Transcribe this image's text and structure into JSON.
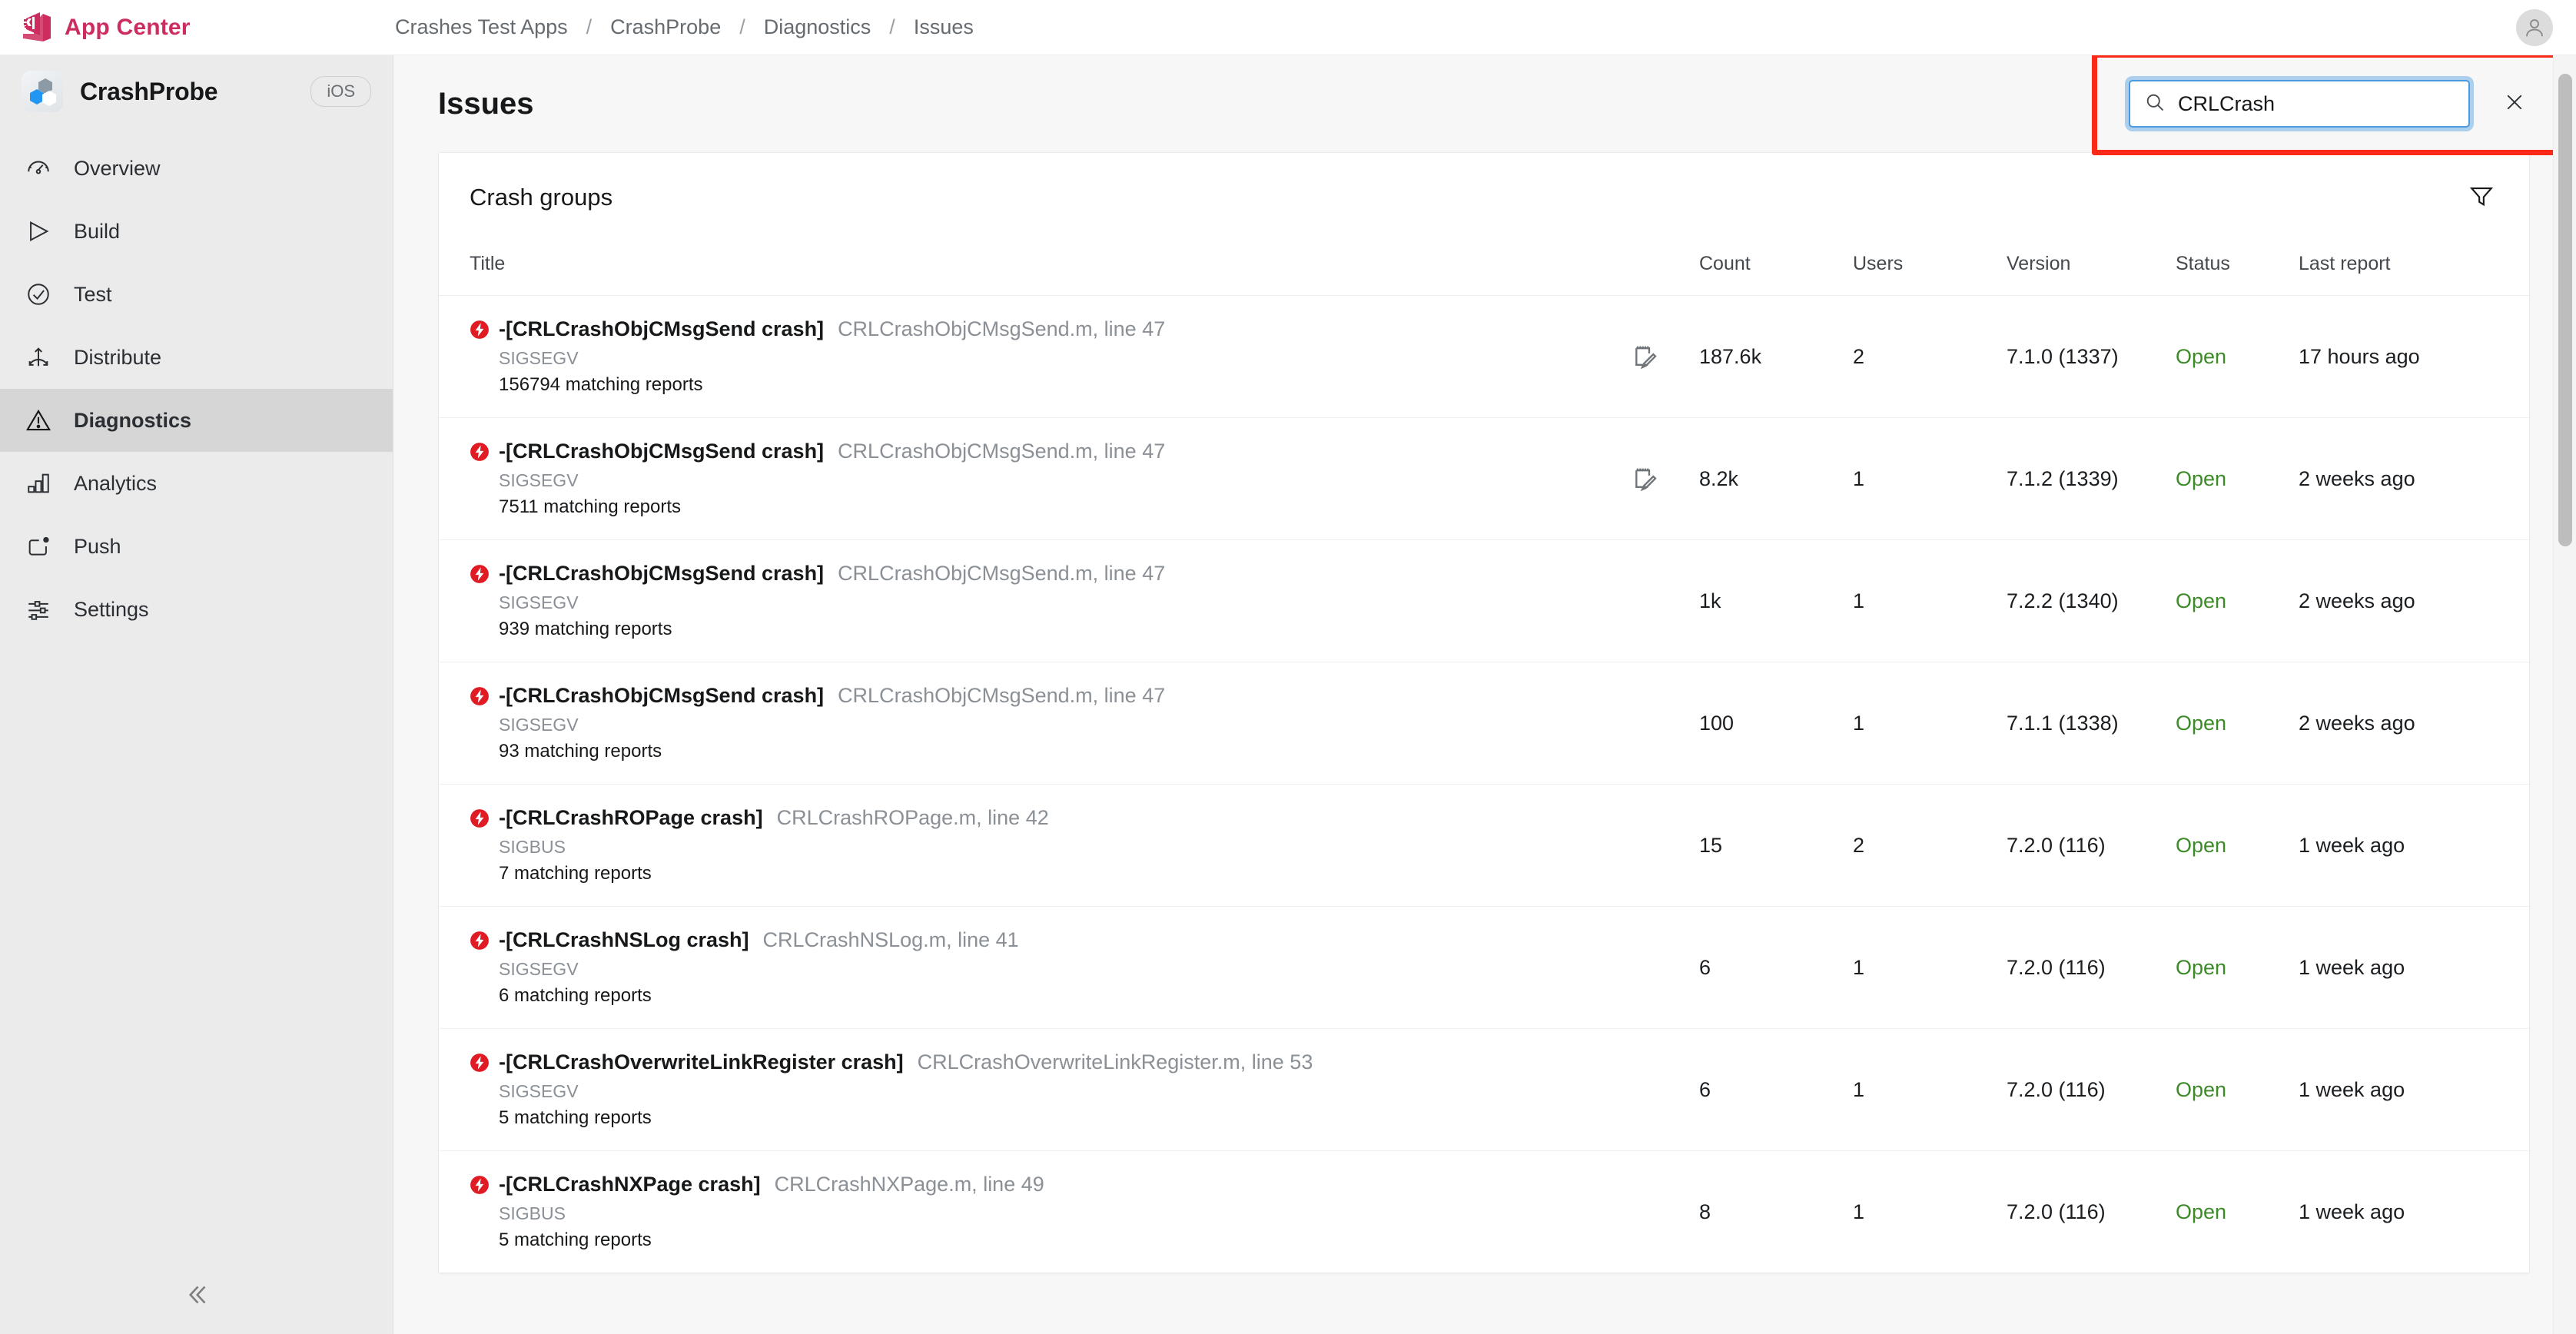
{
  "topbar": {
    "brand_name": "App Center",
    "brand_logo_icon": "app-center-logo",
    "avatar_icon": "user-avatar-icon",
    "breadcrumb": [
      {
        "label": "Crashes Test Apps"
      },
      {
        "label": "CrashProbe"
      },
      {
        "label": "Diagnostics"
      },
      {
        "label": "Issues"
      }
    ],
    "breadcrumb_separator": "/"
  },
  "sidebar": {
    "app_name": "CrashProbe",
    "app_icon": "crashprobe-app-icon",
    "os_badge": "iOS",
    "collapse_icon": "chevron-double-left-icon",
    "items": [
      {
        "label": "Overview",
        "icon": "gauge-icon",
        "active": false
      },
      {
        "label": "Build",
        "icon": "play-icon",
        "active": false
      },
      {
        "label": "Test",
        "icon": "check-circle-icon",
        "active": false
      },
      {
        "label": "Distribute",
        "icon": "distribute-icon",
        "active": false
      },
      {
        "label": "Diagnostics",
        "icon": "warning-triangle-icon",
        "active": true
      },
      {
        "label": "Analytics",
        "icon": "bar-chart-icon",
        "active": false
      },
      {
        "label": "Push",
        "icon": "push-icon",
        "active": false
      },
      {
        "label": "Settings",
        "icon": "sliders-icon",
        "active": false
      }
    ]
  },
  "main": {
    "page_title": "Issues",
    "search": {
      "value": "CRLCrash",
      "placeholder": "Search",
      "search_icon": "search-icon",
      "clear_icon": "close-icon",
      "highlight_color": "#fb2a18",
      "focus_color": "#4a9ae0"
    },
    "card": {
      "title": "Crash groups",
      "filter_icon": "filter-funnel-icon",
      "columns": {
        "title": "Title",
        "count": "Count",
        "users": "Users",
        "version": "Version",
        "status": "Status",
        "last_report": "Last report"
      },
      "status_color": "#3c8a28",
      "crash_icon": "crash-bolt-icon",
      "note_icon": "note-edit-icon",
      "rows": [
        {
          "method": "-[CRLCrashObjCMsgSend crash]",
          "file": "CRLCrashObjCMsgSend.m, line 47",
          "signal": "SIGSEGV",
          "reports": "156794 matching reports",
          "has_note": true,
          "count": "187.6k",
          "users": "2",
          "version": "7.1.0 (1337)",
          "status": "Open",
          "last_report": "17 hours ago"
        },
        {
          "method": "-[CRLCrashObjCMsgSend crash]",
          "file": "CRLCrashObjCMsgSend.m, line 47",
          "signal": "SIGSEGV",
          "reports": "7511 matching reports",
          "has_note": true,
          "count": "8.2k",
          "users": "1",
          "version": "7.1.2 (1339)",
          "status": "Open",
          "last_report": "2 weeks ago"
        },
        {
          "method": "-[CRLCrashObjCMsgSend crash]",
          "file": "CRLCrashObjCMsgSend.m, line 47",
          "signal": "SIGSEGV",
          "reports": "939 matching reports",
          "has_note": false,
          "count": "1k",
          "users": "1",
          "version": "7.2.2 (1340)",
          "status": "Open",
          "last_report": "2 weeks ago"
        },
        {
          "method": "-[CRLCrashObjCMsgSend crash]",
          "file": "CRLCrashObjCMsgSend.m, line 47",
          "signal": "SIGSEGV",
          "reports": "93 matching reports",
          "has_note": false,
          "count": "100",
          "users": "1",
          "version": "7.1.1 (1338)",
          "status": "Open",
          "last_report": "2 weeks ago"
        },
        {
          "method": "-[CRLCrashROPage crash]",
          "file": "CRLCrashROPage.m, line 42",
          "signal": "SIGBUS",
          "reports": "7 matching reports",
          "has_note": false,
          "count": "15",
          "users": "2",
          "version": "7.2.0 (116)",
          "status": "Open",
          "last_report": "1 week ago"
        },
        {
          "method": "-[CRLCrashNSLog crash]",
          "file": "CRLCrashNSLog.m, line 41",
          "signal": "SIGSEGV",
          "reports": "6 matching reports",
          "has_note": false,
          "count": "6",
          "users": "1",
          "version": "7.2.0 (116)",
          "status": "Open",
          "last_report": "1 week ago"
        },
        {
          "method": "-[CRLCrashOverwriteLinkRegister crash]",
          "file": "CRLCrashOverwriteLinkRegister.m, line 53",
          "signal": "SIGSEGV",
          "reports": "5 matching reports",
          "has_note": false,
          "count": "6",
          "users": "1",
          "version": "7.2.0 (116)",
          "status": "Open",
          "last_report": "1 week ago"
        },
        {
          "method": "-[CRLCrashNXPage crash]",
          "file": "CRLCrashNXPage.m, line 49",
          "signal": "SIGBUS",
          "reports": "5 matching reports",
          "has_note": false,
          "count": "8",
          "users": "1",
          "version": "7.2.0 (116)",
          "status": "Open",
          "last_report": "1 week ago"
        }
      ]
    },
    "scrollbar_icon": "vertical-scrollbar"
  }
}
